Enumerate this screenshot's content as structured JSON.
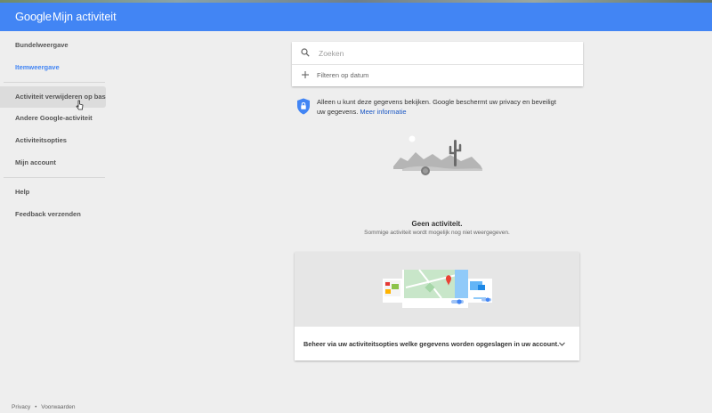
{
  "header": {
    "logo": "Google",
    "title": "Mijn activiteit"
  },
  "sidebar": {
    "items": [
      {
        "label": "Bundelweergave"
      },
      {
        "label": "Itemweergave"
      },
      {
        "label": "Activiteit verwijderen op basis v"
      },
      {
        "label": "Andere Google-activiteit"
      },
      {
        "label": "Activiteitsopties"
      },
      {
        "label": "Mijn account"
      },
      {
        "label": "Help"
      },
      {
        "label": "Feedback verzenden"
      }
    ]
  },
  "search": {
    "placeholder": "Zoeken",
    "value": "",
    "filter_label": "Filteren op datum"
  },
  "privacy": {
    "text": "Alleen u kunt deze gegevens bekijken. Google beschermt uw privacy en beveiligt uw gegevens.",
    "link": "Meer informatie"
  },
  "empty_state": {
    "title": "Geen activiteit.",
    "subtitle": "Sommige activiteit wordt mogelijk nog niet weergegeven."
  },
  "promo": {
    "text": "Beheer via uw activiteitsopties welke gegevens worden opgeslagen in uw account."
  },
  "footer": {
    "privacy": "Privacy",
    "separator": "•",
    "terms": "Voorwaarden"
  },
  "colors": {
    "accent": "#4285f4",
    "link": "#1a57c4",
    "background": "#eeeeee"
  }
}
